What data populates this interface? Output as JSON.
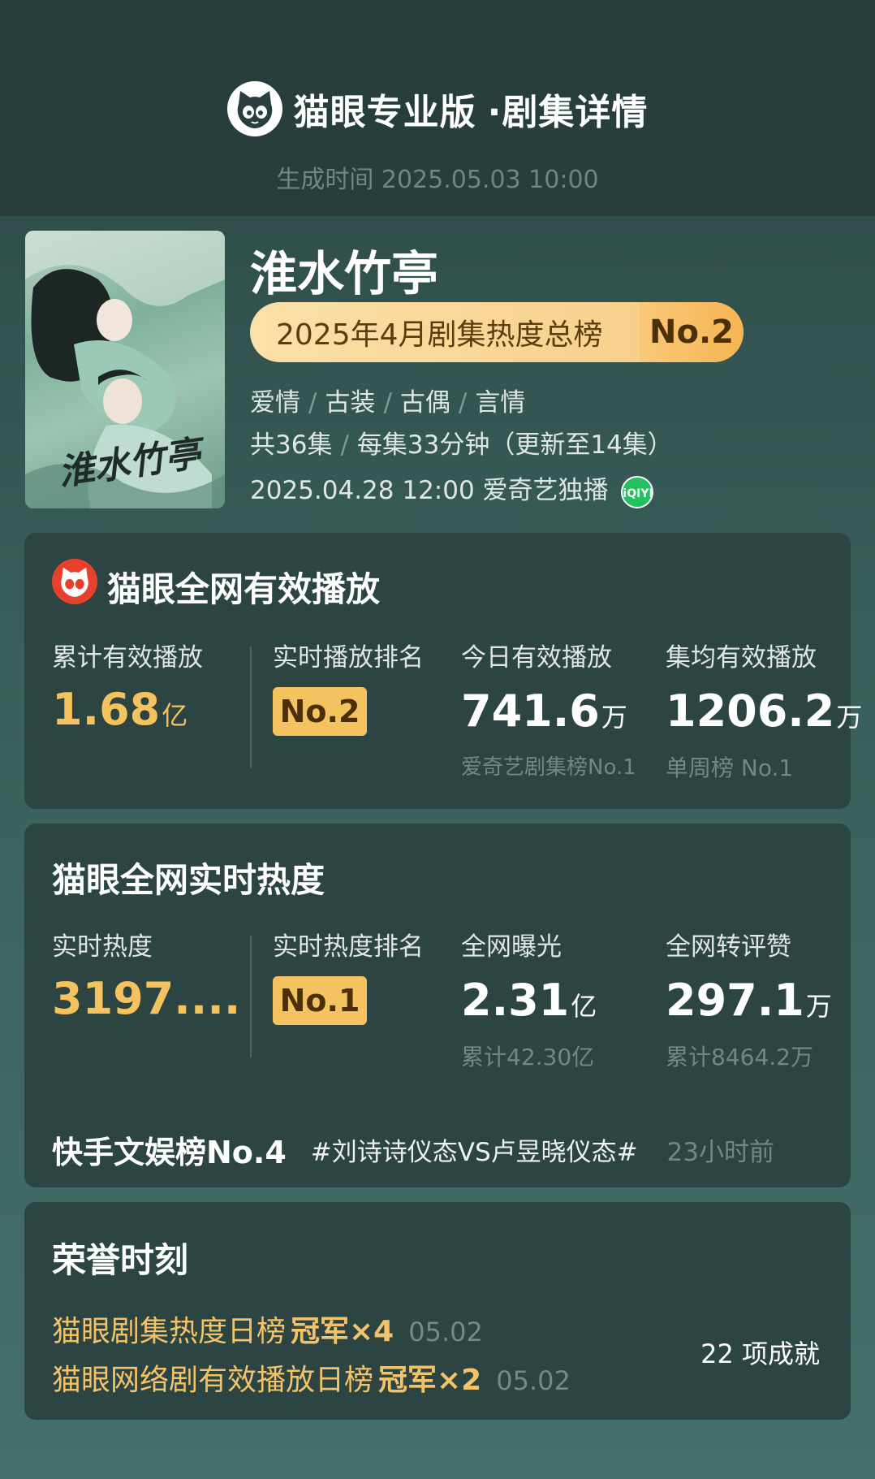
{
  "header": {
    "brand": "猫眼专业版",
    "section": "·剧集详情",
    "generated_time": "生成时间 2025.05.03 10:00"
  },
  "drama": {
    "title": "淮水竹亭",
    "poster_title": "淮水竹亭",
    "rank_text": "2025年4月剧集热度总榜",
    "rank_badge": "No.2",
    "genres": [
      "爱情",
      "古装",
      "古偶",
      "言情"
    ],
    "episodes": "共36集",
    "episode_length": "每集33分钟（更新至14集）",
    "release": "2025.04.28 12:00 爱奇艺独播",
    "platform_icon": "iqiyi-icon",
    "platform_icon_text": "iQIYI"
  },
  "plays": {
    "title": "猫眼全网有效播放",
    "total_label": "累计有效播放",
    "total_value": "1.68",
    "total_unit": "亿",
    "rank_label": "实时播放排名",
    "rank_value": "No.2",
    "today_label": "今日有效播放",
    "today_value": "741.6",
    "today_unit": "万",
    "today_sub": "爱奇艺剧集榜No.1",
    "avg_label": "集均有效播放",
    "avg_value": "1206.2",
    "avg_unit": "万",
    "avg_sub": "单周榜 No.1"
  },
  "heat": {
    "title": "猫眼全网实时热度",
    "realtime_label": "实时热度",
    "realtime_value": "3197....",
    "rank_label": "实时热度排名",
    "rank_value": "No.1",
    "exposure_label": "全网曝光",
    "exposure_value": "2.31",
    "exposure_unit": "亿",
    "exposure_sub": "累计42.30亿",
    "engage_label": "全网转评赞",
    "engage_value": "297.1",
    "engage_unit": "万",
    "engage_sub": "累计8464.2万",
    "trend_rank": "快手文娱榜No.4",
    "trend_tag": "#刘诗诗仪态VS卢昱晓仪态#",
    "trend_time": "23小时前"
  },
  "honors": {
    "title": "荣誉时刻",
    "items": [
      {
        "name": "猫眼剧集热度日榜",
        "title": "冠军×4",
        "date": "05.02"
      },
      {
        "name": "猫眼网络剧有效播放日榜",
        "title": "冠军×2",
        "date": "05.02"
      }
    ],
    "count": "22 项成就"
  },
  "colors": {
    "background": "#3a5f5a",
    "card": "#2c4442",
    "gold": "#f4c25e"
  }
}
